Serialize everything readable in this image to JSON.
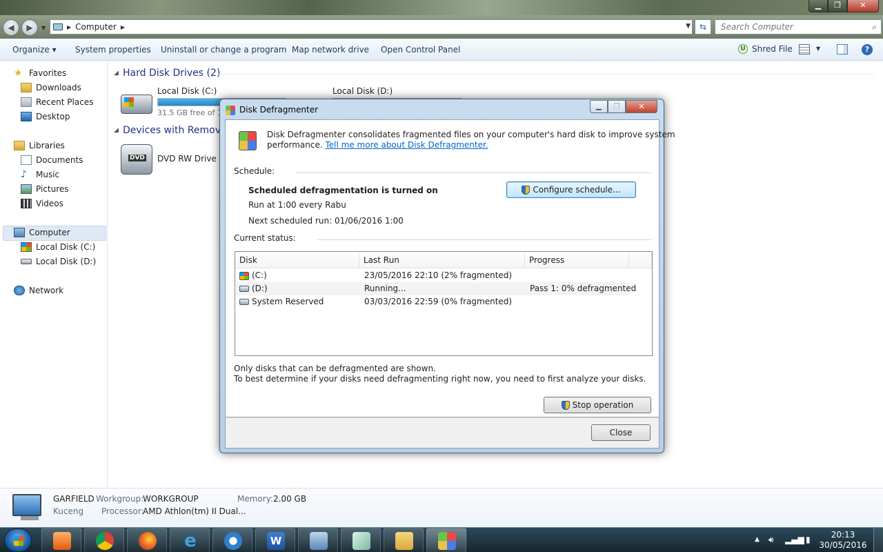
{
  "explorer": {
    "breadcrumb": "Computer",
    "search_placeholder": "Search Computer",
    "toolbar": {
      "organize": "Organize ▾",
      "system_properties": "System properties",
      "uninstall": "Uninstall or change a program",
      "map_drive": "Map network drive",
      "control_panel": "Open Control Panel",
      "shred_file": "Shred File"
    },
    "nav": {
      "favorites": "Favorites",
      "downloads": "Downloads",
      "recent_places": "Recent Places",
      "desktop": "Desktop",
      "libraries": "Libraries",
      "documents": "Documents",
      "music": "Music",
      "pictures": "Pictures",
      "videos": "Videos",
      "computer": "Computer",
      "local_c": "Local Disk (C:)",
      "local_d": "Local Disk (D:)",
      "network": "Network"
    },
    "groups": {
      "hard_disks": "Hard Disk Drives (2)",
      "devices": "Devices with Remova"
    },
    "drives": [
      {
        "name": "Local Disk (C:)",
        "free_text": "31.5 GB free of 15",
        "used_fraction": 0.8
      },
      {
        "name": "Local Disk (D:)",
        "free_text": "",
        "used_fraction": 0.9
      }
    ],
    "dvd_name": "DVD RW Drive (E:",
    "details": {
      "computer_name": "GARFIELD",
      "workgroup_label": "Workgroup:",
      "workgroup_value": "WORKGROUP",
      "memory_label": "Memory:",
      "memory_value": "2.00 GB",
      "description": "Kuceng",
      "processor_label": "Processor:",
      "processor_value": "AMD Athlon(tm) II Dual..."
    }
  },
  "dialog": {
    "title": "Disk Defragmenter",
    "intro_line1": "Disk Defragmenter consolidates fragmented files on your computer's hard disk to improve system",
    "intro_line2": "performance.",
    "intro_link": "Tell me more about Disk Defragmenter.",
    "schedule_label": "Schedule:",
    "schedule_status": "Scheduled defragmentation is turned on",
    "schedule_run": "Run at 1:00 every Rabu",
    "schedule_next": "Next scheduled run: 01/06/2016 1:00",
    "configure_button": "Configure schedule...",
    "current_status_label": "Current status:",
    "columns": [
      "Disk",
      "Last Run",
      "Progress"
    ],
    "disks": [
      {
        "disk": "(C:)",
        "last_run": "23/05/2016 22:10 (2% fragmented)",
        "progress": ""
      },
      {
        "disk": "(D:)",
        "last_run": "Running...",
        "progress": "Pass 1: 0% defragmented"
      },
      {
        "disk": "System Reserved",
        "last_run": "03/03/2016 22:59 (0% fragmented)",
        "progress": ""
      }
    ],
    "note_line1": "Only disks that can be defragmented are shown.",
    "note_line2": "To best determine if your disks need defragmenting right now, you need to first analyze your disks.",
    "stop_button": "Stop operation",
    "close_button": "Close"
  },
  "taskbar": {
    "time": "20:13",
    "date": "30/05/2016"
  }
}
